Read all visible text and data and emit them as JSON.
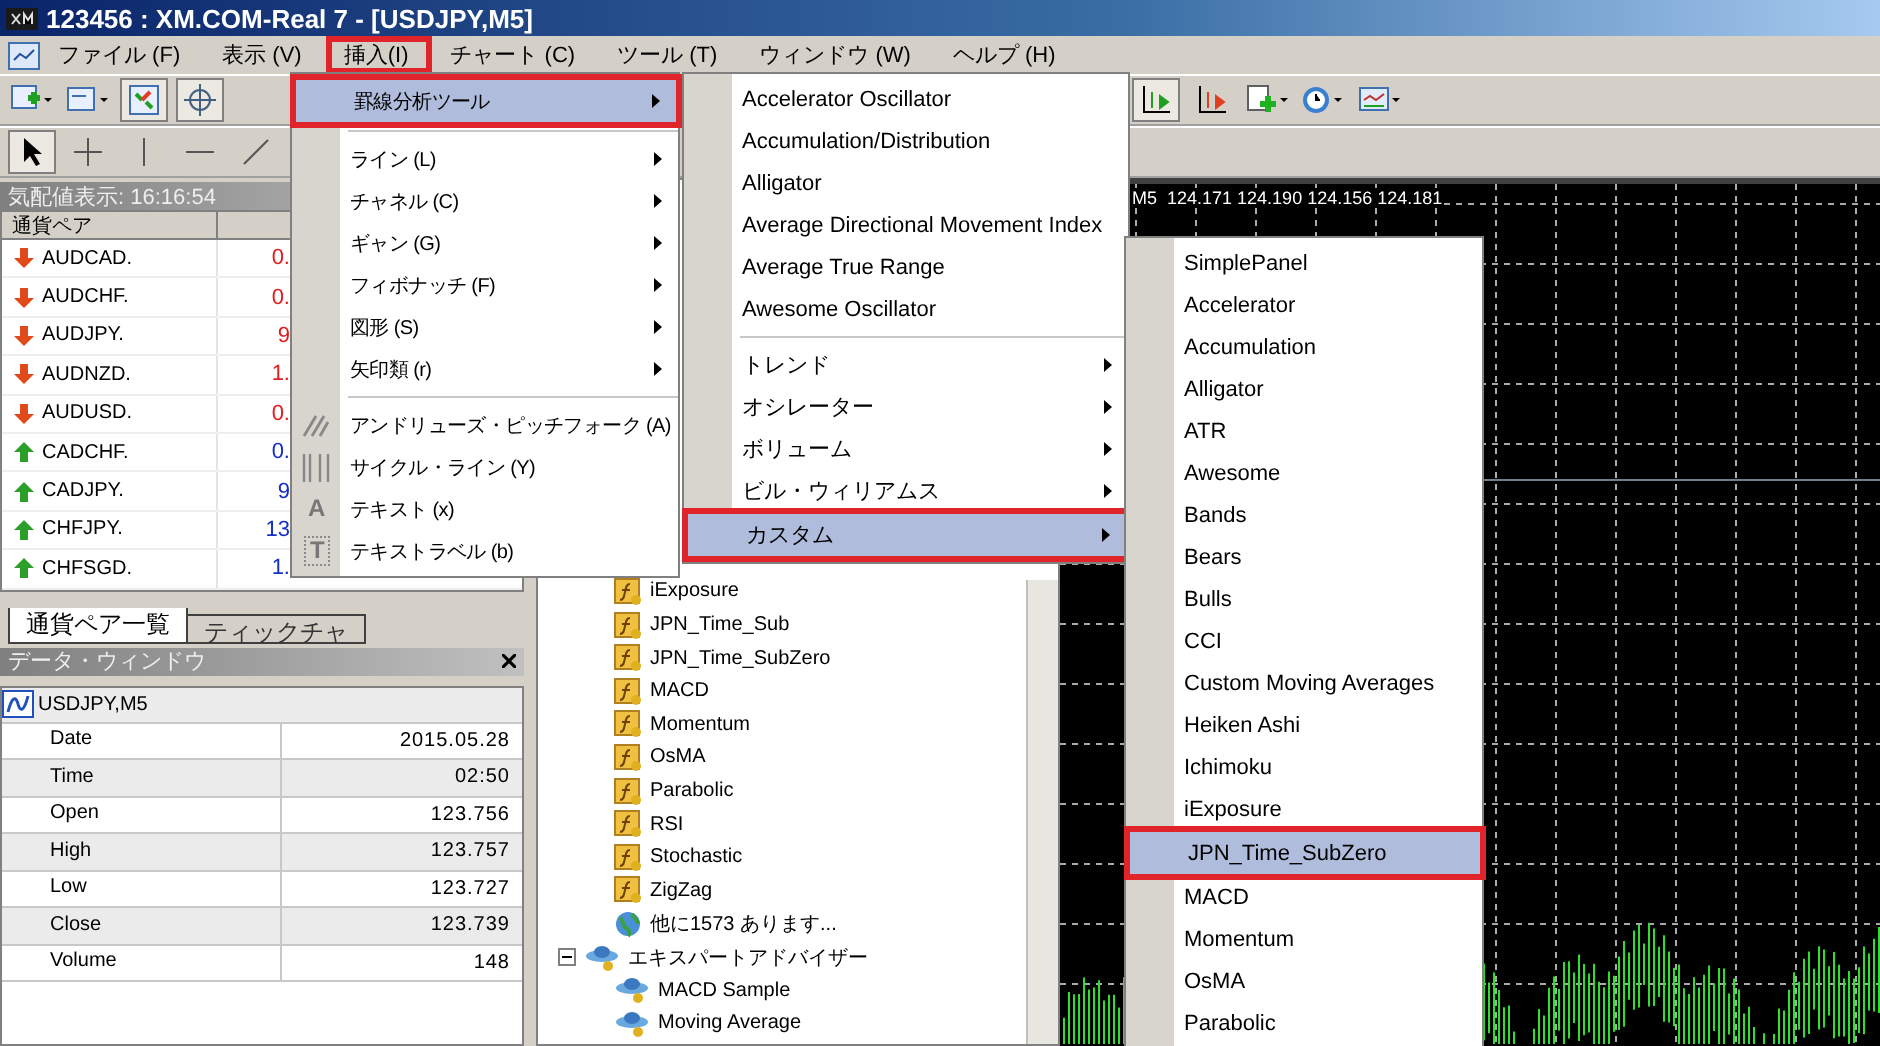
{
  "window": {
    "title": "123456 : XM.COM-Real 7 - [USDJPY,M5]"
  },
  "menu_bar": [
    {
      "label": "ファイル (F)",
      "selected": false
    },
    {
      "label": "表示 (V)",
      "selected": false
    },
    {
      "label": "挿入(I)",
      "selected": true
    },
    {
      "label": "チャート (C)",
      "selected": false
    },
    {
      "label": "ツール (T)",
      "selected": false
    },
    {
      "label": "ウィンドウ (W)",
      "selected": false
    },
    {
      "label": "ヘルプ (H)",
      "selected": false
    }
  ],
  "market_watch": {
    "title": "気配値表示: 16:16:54",
    "columns": [
      "通貨ペア"
    ],
    "rows": [
      {
        "symbol": "AUDCAD.",
        "bid": "0.",
        "rising": false
      },
      {
        "symbol": "AUDCHF.",
        "bid": "0.",
        "rising": false
      },
      {
        "symbol": "AUDJPY.",
        "bid": "9",
        "rising": false
      },
      {
        "symbol": "AUDNZD.",
        "bid": "1.",
        "rising": false
      },
      {
        "symbol": "AUDUSD.",
        "bid": "0.",
        "rising": false
      },
      {
        "symbol": "CADCHF.",
        "bid": "0.",
        "rising": true
      },
      {
        "symbol": "CADJPY.",
        "bid": "9",
        "rising": true
      },
      {
        "symbol": "CHFJPY.",
        "bid": "13",
        "rising": true
      },
      {
        "symbol": "CHFSGD.",
        "bid": "1.",
        "rising": true
      }
    ],
    "tabs": [
      {
        "label": "通貨ペア一覧",
        "selected": true
      },
      {
        "label": "ティックチャ",
        "selected": false
      }
    ]
  },
  "data_window": {
    "title": "データ・ウィンドウ",
    "symbol": "USDJPY,M5",
    "rows": [
      {
        "label": "Date",
        "value": "2015.05.28"
      },
      {
        "label": "Time",
        "value": "02:50"
      },
      {
        "label": "Open",
        "value": "123.756"
      },
      {
        "label": "High",
        "value": "123.757"
      },
      {
        "label": "Low",
        "value": "123.727"
      },
      {
        "label": "Close",
        "value": "123.739"
      },
      {
        "label": "Volume",
        "value": "148"
      }
    ]
  },
  "navigator": {
    "indicators": [
      {
        "label": "iExposure",
        "kind": "indicator"
      },
      {
        "label": "JPN_Time_Sub",
        "kind": "indicator"
      },
      {
        "label": "JPN_Time_SubZero",
        "kind": "indicator"
      },
      {
        "label": "MACD",
        "kind": "indicator"
      },
      {
        "label": "Momentum",
        "kind": "indicator"
      },
      {
        "label": "OsMA",
        "kind": "indicator"
      },
      {
        "label": "Parabolic",
        "kind": "indicator"
      },
      {
        "label": "RSI",
        "kind": "indicator"
      },
      {
        "label": "Stochastic",
        "kind": "indicator"
      },
      {
        "label": "ZigZag",
        "kind": "indicator"
      },
      {
        "label": "他に1573 あります...",
        "kind": "more"
      }
    ],
    "groups": [
      {
        "label": "エキスパートアドバイザー",
        "expanded": true,
        "children": [
          {
            "label": "MACD Sample"
          },
          {
            "label": "Moving Average"
          }
        ]
      }
    ]
  },
  "chart": {
    "header": "M5  124.171 124.190 124.156 124.181"
  },
  "insert_menu": [
    {
      "kind": "item",
      "label": "罫線分析ツール",
      "submenu": true,
      "selected": true
    },
    {
      "kind": "separator"
    },
    {
      "kind": "item",
      "label": "ライン (L)",
      "submenu": true,
      "selected": false
    },
    {
      "kind": "item",
      "label": "チャネル (C)",
      "submenu": true,
      "selected": false
    },
    {
      "kind": "item",
      "label": "ギャン (G)",
      "submenu": true,
      "selected": false
    },
    {
      "kind": "item",
      "label": "フィボナッチ (F)",
      "submenu": true,
      "selected": false
    },
    {
      "kind": "item",
      "label": "図形 (S)",
      "submenu": true,
      "selected": false
    },
    {
      "kind": "item",
      "label": "矢印類 (r)",
      "submenu": true,
      "selected": false
    },
    {
      "kind": "separator"
    },
    {
      "kind": "pitchfork",
      "label": "アンドリューズ・ピッチフォーク (A)",
      "submenu": false,
      "selected": false
    },
    {
      "kind": "cycle",
      "label": "サイクル・ライン (Y)",
      "submenu": false,
      "selected": false
    },
    {
      "kind": "item",
      "label": "テキスト (x)",
      "glyph": "A",
      "submenu": false,
      "selected": false
    },
    {
      "kind": "item",
      "label": "テキストラベル (b)",
      "glyph": "T",
      "submenu": false,
      "selected": false
    }
  ],
  "indicators_menu": [
    {
      "kind": "item",
      "label": "Accelerator Oscillator",
      "submenu": false,
      "selected": false
    },
    {
      "kind": "item",
      "label": "Accumulation/Distribution",
      "submenu": false,
      "selected": false
    },
    {
      "kind": "item",
      "label": "Alligator",
      "submenu": false,
      "selected": false
    },
    {
      "kind": "item",
      "label": "Average Directional Movement Index",
      "submenu": false,
      "selected": false
    },
    {
      "kind": "item",
      "label": "Average True Range",
      "submenu": false,
      "selected": false
    },
    {
      "kind": "item",
      "label": "Awesome Oscillator",
      "submenu": false,
      "selected": false
    },
    {
      "kind": "separator"
    },
    {
      "kind": "item",
      "label": "トレンド",
      "submenu": true,
      "selected": false
    },
    {
      "kind": "item",
      "label": "オシレーター",
      "submenu": true,
      "selected": false
    },
    {
      "kind": "item",
      "label": "ボリューム",
      "submenu": true,
      "selected": false
    },
    {
      "kind": "item",
      "label": "ビル・ウィリアムス",
      "submenu": true,
      "selected": false
    },
    {
      "kind": "item",
      "label": "カスタム",
      "submenu": true,
      "selected": true
    }
  ],
  "custom_menu": [
    {
      "kind": "item",
      "label": "SimplePanel",
      "submenu": false,
      "selected": false
    },
    {
      "kind": "item",
      "label": "Accelerator",
      "submenu": false,
      "selected": false
    },
    {
      "kind": "item",
      "label": "Accumulation",
      "submenu": false,
      "selected": false
    },
    {
      "kind": "item",
      "label": "Alligator",
      "submenu": false,
      "selected": false
    },
    {
      "kind": "item",
      "label": "ATR",
      "submenu": false,
      "selected": false
    },
    {
      "kind": "item",
      "label": "Awesome",
      "submenu": false,
      "selected": false
    },
    {
      "kind": "item",
      "label": "Bands",
      "submenu": false,
      "selected": false
    },
    {
      "kind": "item",
      "label": "Bears",
      "submenu": false,
      "selected": false
    },
    {
      "kind": "item",
      "label": "Bulls",
      "submenu": false,
      "selected": false
    },
    {
      "kind": "item",
      "label": "CCI",
      "submenu": false,
      "selected": false
    },
    {
      "kind": "item",
      "label": "Custom Moving Averages",
      "submenu": false,
      "selected": false
    },
    {
      "kind": "item",
      "label": "Heiken Ashi",
      "submenu": false,
      "selected": false
    },
    {
      "kind": "item",
      "label": "Ichimoku",
      "submenu": false,
      "selected": false
    },
    {
      "kind": "item",
      "label": "iExposure",
      "submenu": false,
      "selected": false
    },
    {
      "kind": "item",
      "label": "JPN_Time_SubZero",
      "submenu": false,
      "selected": true
    },
    {
      "kind": "item",
      "label": "MACD",
      "submenu": false,
      "selected": false
    },
    {
      "kind": "item",
      "label": "Momentum",
      "submenu": false,
      "selected": false
    },
    {
      "kind": "item",
      "label": "OsMA",
      "submenu": false,
      "selected": false
    },
    {
      "kind": "item",
      "label": "Parabolic",
      "submenu": false,
      "selected": false
    }
  ]
}
